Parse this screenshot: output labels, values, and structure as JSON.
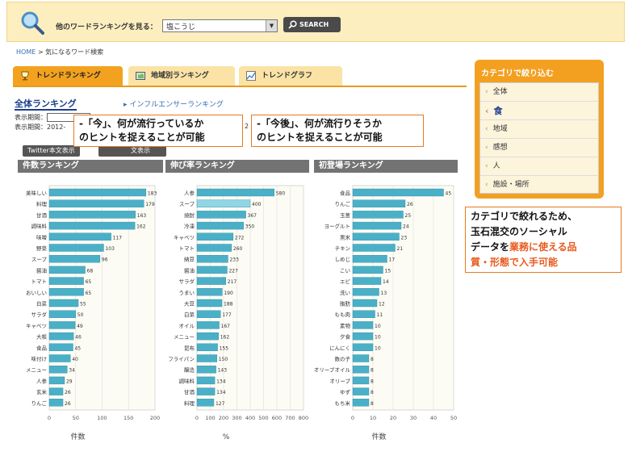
{
  "topbar": {
    "label": "他のワードランキングを見る：",
    "select_value": "塩こうじ",
    "search_label": "SEARCH"
  },
  "breadcrumb": {
    "home": "HOME",
    "sep": " > ",
    "current": "気になるワード検索"
  },
  "tabs": [
    {
      "label": "トレンドランキング"
    },
    {
      "label": "地域別ランキング"
    },
    {
      "label": "トレンドグラフ"
    }
  ],
  "subnav": {
    "main": "全体ランキング",
    "alt": "インフルエンサーランキング"
  },
  "period": {
    "label1": "表示期間：",
    "label2": "表示期間：2012-",
    "trail": "2"
  },
  "buttons": {
    "twitter": "Twitter本文表示",
    "other": "文表示"
  },
  "callouts": {
    "now_line1": "-「今」、何が流行っているか",
    "now_line2": "のヒントを捉えることが可能",
    "future_line1": "-「今後」、何が流行りそうか",
    "future_line2": "のヒントを捉えることが可能",
    "cat_line1": "カテゴリで絞れるため、",
    "cat_line2": "玉石混交のソーシャル",
    "cat_line3a": "データを",
    "cat_line3b": "業務に使える品",
    "cat_line4": "質・形態で入手可能"
  },
  "sidebar": {
    "title": "カテゴリで絞り込む",
    "items": [
      {
        "label": "全体"
      },
      {
        "label": "食"
      },
      {
        "label": "地域"
      },
      {
        "label": "感想"
      },
      {
        "label": "人"
      },
      {
        "label": "施設・場所"
      }
    ]
  },
  "colors": {
    "bar": "#4ab0c8",
    "bar_highlight": "#8fd6e6",
    "accent": "#f3a021"
  },
  "chart_data": [
    {
      "type": "bar",
      "title": "件数ランキング",
      "xlabel": "件数",
      "xlim": [
        0,
        200
      ],
      "ticks": [
        0,
        50,
        100,
        150,
        200
      ],
      "categories": [
        "美味しい",
        "料理",
        "甘酒",
        "調味料",
        "味噌",
        "野菜",
        "スープ",
        "醤油",
        "トマト",
        "おいしい",
        "白菜",
        "サラダ",
        "キャベツ",
        "大根",
        "食品",
        "味付け",
        "メニュー",
        "人参",
        "玄米",
        "りんご"
      ],
      "values": [
        183,
        179,
        163,
        162,
        117,
        103,
        96,
        68,
        65,
        65,
        55,
        50,
        49,
        46,
        45,
        40,
        34,
        29,
        26,
        26
      ]
    },
    {
      "type": "bar",
      "title": "伸び率ランキング",
      "xlabel": "%",
      "xlim": [
        0,
        800
      ],
      "ticks": [
        0,
        100,
        200,
        300,
        400,
        500,
        600,
        700,
        800
      ],
      "categories": [
        "人参",
        "スープ",
        "焼酎",
        "冷凍",
        "キャベツ",
        "トマト",
        "納豆",
        "醤油",
        "サラダ",
        "うまい",
        "大豆",
        "白菜",
        "オイル",
        "メニュー",
        "昆布",
        "フライパン",
        "醸造",
        "調味料",
        "甘酒",
        "料理"
      ],
      "values": [
        580,
        400,
        367,
        350,
        272,
        260,
        233,
        227,
        217,
        190,
        188,
        177,
        167,
        162,
        155,
        150,
        143,
        134,
        134,
        127
      ]
    },
    {
      "type": "bar",
      "title": "初登場ランキング",
      "xlabel": "件数",
      "xlim": [
        0,
        50
      ],
      "ticks": [
        0,
        10,
        20,
        30,
        40,
        50
      ],
      "categories": [
        "食品",
        "りんご",
        "玉葱",
        "ヨーグルト",
        "黒米",
        "チキン",
        "しめじ",
        "こい",
        "エビ",
        "洗い",
        "脂肪",
        "もも肉",
        "素物",
        "夕食",
        "にんにく",
        "数の子",
        "オリーブオイル",
        "オリーブ",
        "ゆず",
        "もち米"
      ],
      "values": [
        45,
        26,
        25,
        24,
        23,
        21,
        17,
        15,
        14,
        13,
        12,
        11,
        10,
        10,
        10,
        8,
        8,
        8,
        8,
        8
      ]
    }
  ]
}
